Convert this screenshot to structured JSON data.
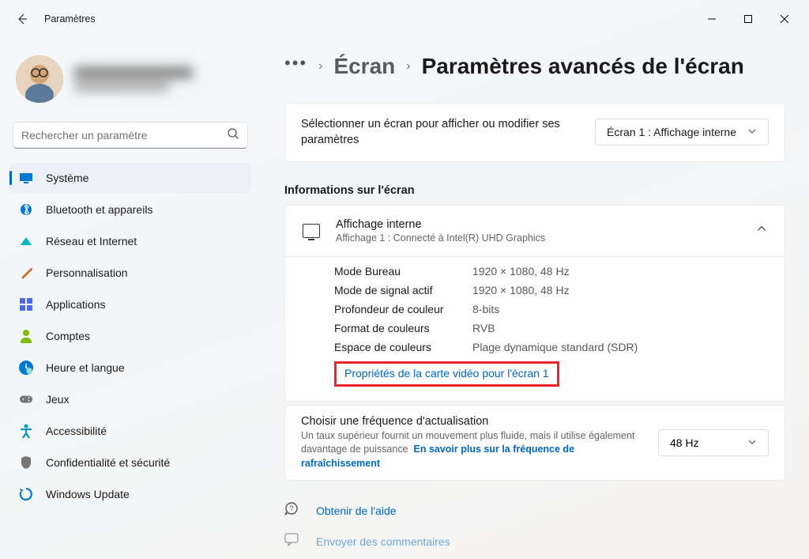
{
  "window": {
    "title": "Paramètres"
  },
  "user": {
    "name": "",
    "email": ""
  },
  "search": {
    "placeholder": "Rechercher un paramètre"
  },
  "sidebar": {
    "items": [
      {
        "label": "Système",
        "icon": "system",
        "color": "#0078d4"
      },
      {
        "label": "Bluetooth et appareils",
        "icon": "bluetooth",
        "color": "#0078d4"
      },
      {
        "label": "Réseau et Internet",
        "icon": "network",
        "color": "#00b7c3"
      },
      {
        "label": "Personnalisation",
        "icon": "personalization",
        "color": "#e3008c"
      },
      {
        "label": "Applications",
        "icon": "apps",
        "color": "#4f6bed"
      },
      {
        "label": "Comptes",
        "icon": "accounts",
        "color": "#7fba00"
      },
      {
        "label": "Heure et langue",
        "icon": "time",
        "color": "#0078d4"
      },
      {
        "label": "Jeux",
        "icon": "gaming",
        "color": "#767676"
      },
      {
        "label": "Accessibilité",
        "icon": "accessibility",
        "color": "#0099bc"
      },
      {
        "label": "Confidentialité et sécurité",
        "icon": "privacy",
        "color": "#767676"
      },
      {
        "label": "Windows Update",
        "icon": "update",
        "color": "#0078d4"
      }
    ]
  },
  "breadcrumb": {
    "parent": "Écran",
    "current": "Paramètres avancés de l'écran"
  },
  "selector": {
    "text": "Sélectionner un écran pour afficher ou modifier ses paramètres",
    "value": "Écran 1 : Affichage interne"
  },
  "info": {
    "section_title": "Informations sur l'écran",
    "header_title": "Affichage interne",
    "header_sub": "Affichage 1 : Connecté à Intel(R) UHD Graphics",
    "rows": [
      {
        "k": "Mode Bureau",
        "v": "1920 × 1080, 48 Hz"
      },
      {
        "k": "Mode de signal actif",
        "v": "1920 × 1080, 48 Hz"
      },
      {
        "k": "Profondeur de couleur",
        "v": "8-bits"
      },
      {
        "k": "Format de couleurs",
        "v": "RVB"
      },
      {
        "k": "Espace de couleurs",
        "v": "Plage dynamique standard (SDR)"
      }
    ],
    "adapter_link": "Propriétés de la carte vidéo pour l'écran 1"
  },
  "refresh": {
    "title": "Choisir une fréquence d'actualisation",
    "sub1": "Un taux supérieur fournit un mouvement plus fluide, mais il utilise également davantage de puissance",
    "sub_link": "En savoir plus sur la fréquence de rafraîchissement",
    "value": "48 Hz"
  },
  "help": {
    "get_help": "Obtenir de l'aide",
    "feedback": "Envoyer des commentaires"
  }
}
